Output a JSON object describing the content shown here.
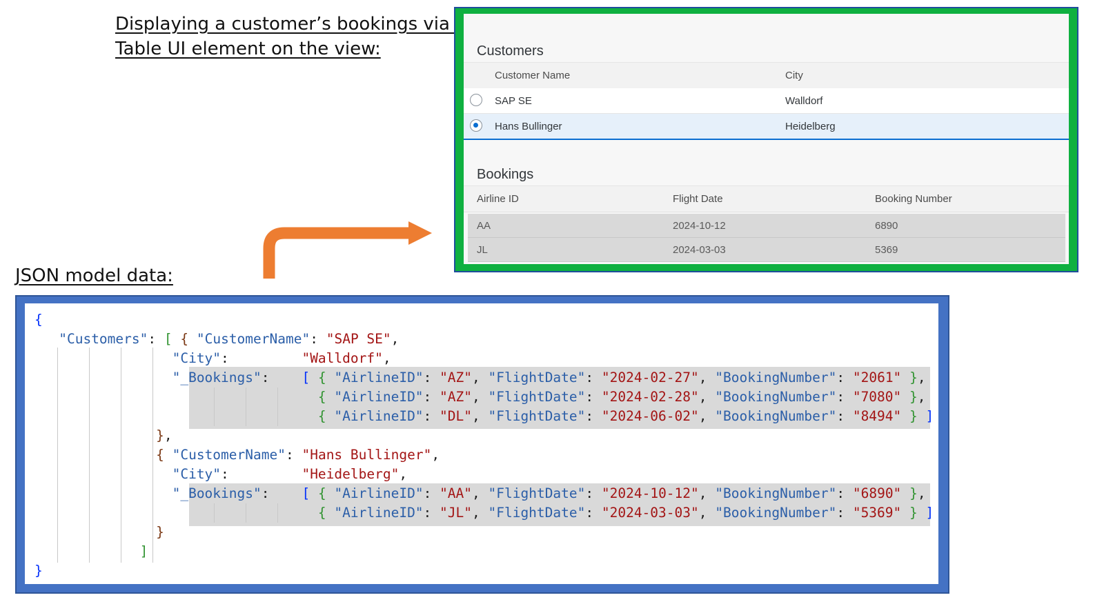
{
  "headings": {
    "main_line1": "Displaying a customer’s bookings via a",
    "main_line2": "Table UI element on the view:",
    "json": "JSON model data:"
  },
  "customers_table": {
    "title": "Customers",
    "columns": [
      "Customer Name",
      "City"
    ],
    "rows": [
      {
        "name": "SAP SE",
        "city": "Walldorf",
        "selected": false
      },
      {
        "name": "Hans Bullinger",
        "city": "Heidelberg",
        "selected": true
      }
    ]
  },
  "bookings_table": {
    "title": "Bookings",
    "columns": [
      "Airline ID",
      "Flight Date",
      "Booking Number"
    ],
    "rows": [
      {
        "airline": "AA",
        "date": "2024-10-12",
        "number": "6890"
      },
      {
        "airline": "JL",
        "date": "2024-03-03",
        "number": "5369"
      }
    ]
  },
  "json_model": {
    "keys": {
      "customers": "\"Customers\"",
      "customer_name": "\"CustomerName\"",
      "city": "\"City\"",
      "bookings": "\"_Bookings\"",
      "airline_id": "\"AirlineID\"",
      "flight_date": "\"FlightDate\"",
      "booking_number": "\"BookingNumber\""
    },
    "customers": [
      {
        "name": "\"SAP SE\"",
        "city": "\"Walldorf\"",
        "bookings": [
          {
            "airline": "\"AZ\"",
            "date": "\"2024-02-27\"",
            "number": "\"2061\""
          },
          {
            "airline": "\"AZ\"",
            "date": "\"2024-02-28\"",
            "number": "\"7080\""
          },
          {
            "airline": "\"DL\"",
            "date": "\"2024-06-02\"",
            "number": "\"8494\""
          }
        ]
      },
      {
        "name": "\"Hans Bullinger\"",
        "city": "\"Heidelberg\"",
        "bookings": [
          {
            "airline": "\"AA\"",
            "date": "\"2024-10-12\"",
            "number": "\"6890\""
          },
          {
            "airline": "\"JL\"",
            "date": "\"2024-03-03\"",
            "number": "\"5369\""
          }
        ]
      }
    ]
  }
}
